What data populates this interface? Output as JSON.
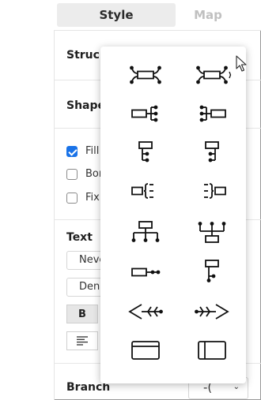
{
  "tabs": {
    "style": "Style",
    "map": "Map"
  },
  "sections": {
    "structure": "Struc",
    "shape": "Shape",
    "text": "Text",
    "branch": "Branch"
  },
  "shape_checks": [
    {
      "label": "Fill",
      "checked": true
    },
    {
      "label": "Bor",
      "checked": false
    },
    {
      "label": "Fix",
      "checked": false
    }
  ],
  "text_fields": {
    "font_value": "Neve",
    "size_value": "Den"
  },
  "text_buttons": {
    "bold": "B"
  },
  "branch_select": {
    "glyph": "-(",
    "chevron": "⌄"
  },
  "structure_options": [
    {
      "name": "map-balanced-icon"
    },
    {
      "name": "map-clockwise-icon"
    },
    {
      "name": "logic-right-icon"
    },
    {
      "name": "logic-left-icon"
    },
    {
      "name": "tree-right-icon"
    },
    {
      "name": "tree-left-icon"
    },
    {
      "name": "brace-right-icon"
    },
    {
      "name": "brace-left-icon"
    },
    {
      "name": "org-chart-down-icon"
    },
    {
      "name": "org-chart-up-icon"
    },
    {
      "name": "timeline-horizontal-icon"
    },
    {
      "name": "timeline-vertical-icon"
    },
    {
      "name": "fishbone-left-icon"
    },
    {
      "name": "fishbone-right-icon"
    },
    {
      "name": "matrix-column-icon"
    },
    {
      "name": "matrix-row-icon"
    }
  ]
}
